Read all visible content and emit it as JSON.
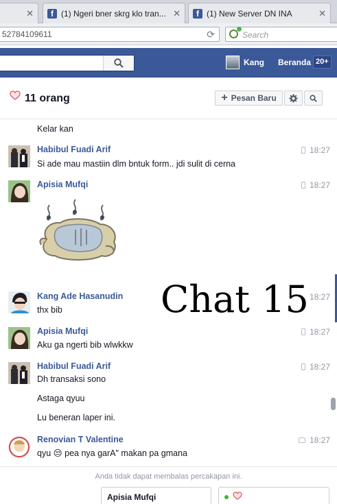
{
  "browser": {
    "tabs": [
      {
        "title": "",
        "has_close": true
      },
      {
        "title": "(1) Ngeri bner skrg klo tran...",
        "has_close": true
      },
      {
        "title": "(1) New Server DN INA",
        "has_close": true
      }
    ],
    "url": "52784109611",
    "search_placeholder": "Search"
  },
  "fb": {
    "user_name": "Kang",
    "home_label": "Beranda",
    "notif_count": "20+"
  },
  "conversation": {
    "members_label": "11 orang",
    "new_message_label": "Pesan Baru"
  },
  "messages": [
    {
      "sender": "",
      "lines": [
        "Kelar kan"
      ],
      "time": ""
    },
    {
      "sender": "Habibul Fuadi Arif",
      "lines": [
        "Si ade mau mastiin dlm bntuk form.. jdi sulit di cerna"
      ],
      "time": "18:27",
      "device": "mobile"
    },
    {
      "sender": "Apisia Mufqi",
      "lines": [],
      "time": "18:27",
      "device": "mobile",
      "sticker": "sleeping-cat-sticker"
    },
    {
      "sender": "Kang Ade Hasanudin",
      "lines": [
        "thx bib"
      ],
      "time": "18:27",
      "device": "none"
    },
    {
      "sender": "Apisia Mufqi",
      "lines": [
        "Aku ga ngerti bib wlwkkw"
      ],
      "time": "18:27",
      "device": "mobile"
    },
    {
      "sender": "Habibul Fuadi Arif",
      "lines": [
        "Dh transaksi sono",
        "Astaga qyuu",
        "Lu beneran laper ini."
      ],
      "time": "18:27",
      "device": "mobile"
    },
    {
      "sender": "Renovian T Valentine",
      "lines": [
        "qyu 😒 pea nya garA\" makan pa gmana"
      ],
      "time": "18:27",
      "device": "chat"
    }
  ],
  "watermark": "Chat 15",
  "footer": {
    "reply_note": "Anda tidak dapat membalas percakapan ini.",
    "chat_tabs": [
      "Apisia Mufqi",
      ""
    ]
  },
  "colors": {
    "fb_blue": "#3b5998",
    "sender_blue": "#3b5998",
    "time_gray": "#9197a3",
    "heart": "#e0515f"
  }
}
